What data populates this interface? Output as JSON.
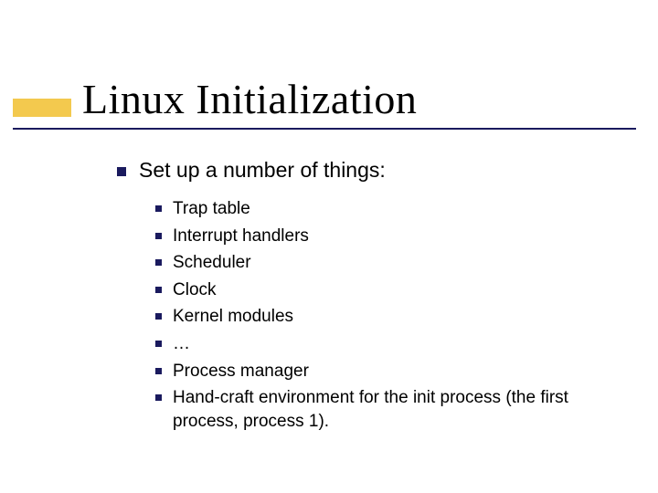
{
  "title": "Linux Initialization",
  "main": {
    "heading": "Set up a number of things:",
    "items": [
      "Trap table",
      "Interrupt handlers",
      "Scheduler",
      "Clock",
      "Kernel modules",
      "…",
      "Process manager",
      "Hand-craft environment for the init process (the first process, process 1)."
    ]
  }
}
